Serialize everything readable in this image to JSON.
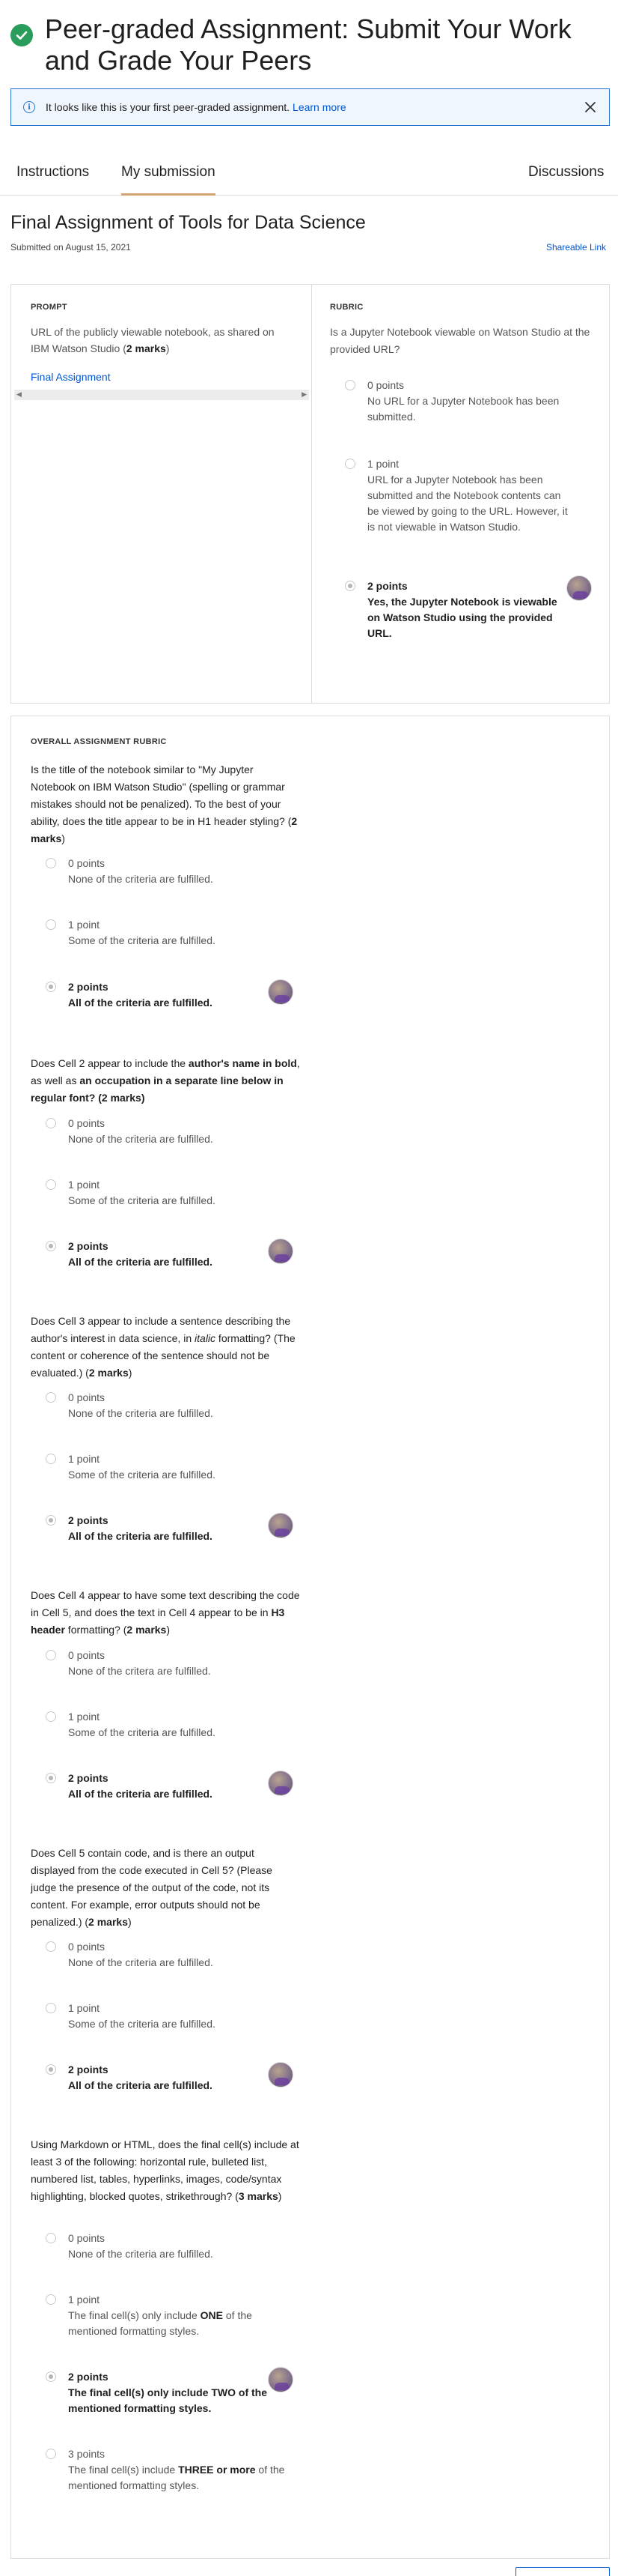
{
  "header": {
    "title": "Peer-graded Assignment: Submit Your Work and Grade Your Peers"
  },
  "banner": {
    "text": "It looks like this is your first peer-graded assignment.",
    "link": "Learn more"
  },
  "tabs": {
    "instructions": "Instructions",
    "my_submission": "My submission",
    "discussions": "Discussions"
  },
  "submission": {
    "title": "Final Assignment of Tools for Data Science",
    "submitted_on": "Submitted on August 15, 2021",
    "share_link": "Shareable Link"
  },
  "prompt": {
    "label": "PROMPT",
    "text_a": "URL of the publicly viewable notebook, as shared on IBM Watson Studio (",
    "text_b": "2 marks",
    "text_c": ")",
    "link": "Final Assignment"
  },
  "rubric": {
    "label": "RUBRIC",
    "question": "Is a Jupyter Notebook viewable on Watson Studio at the provided URL?",
    "options": [
      {
        "points": "0 points",
        "desc": "No URL for a Jupyter Notebook has been submitted."
      },
      {
        "points": "1 point",
        "desc": "URL for a Jupyter Notebook has been submitted and the Notebook contents can be viewed by going to the URL. However, it is not viewable in Watson Studio."
      },
      {
        "points": "2 points",
        "desc": "Yes, the Jupyter Notebook is viewable on Watson Studio using the provided URL."
      }
    ]
  },
  "overall": {
    "label": "OVERALL ASSIGNMENT RUBRIC",
    "q1": {
      "text": "Is the title of the notebook similar to \"My Jupyter Notebook on IBM Watson Studio\" (spelling or grammar mistakes should not be penalized). To the best of your ability, does the title appear to be in H1 header styling? (",
      "marks": "2 marks",
      "end": ")"
    },
    "q2": {
      "a": "Does Cell 2 appear to include the ",
      "b": "author's name in bold",
      "c": ", as well as ",
      "d": "an occupation in a separate line below in regular font?",
      "e": " (2 marks)"
    },
    "q3": {
      "a": "Does Cell 3 appear to include a sentence describing the author's interest in data science, in ",
      "b": "italic",
      "c": " formatting? (The content or coherence of the sentence should not be evaluated.) (",
      "d": "2 marks",
      "e": ")"
    },
    "q4": {
      "a": "Does Cell 4 appear to have some text describing the code in Cell 5, and does the text in Cell 4 appear to be in ",
      "b": "H3 header",
      "c": " formatting? (",
      "d": "2 marks",
      "e": ")"
    },
    "q5": {
      "a": "Does Cell 5 contain code, and is there an output displayed from the code executed in Cell 5? (Please judge the presence of the output of the code, not its content. For example, error outputs should not be penalized.) (",
      "b": "2 marks",
      "c": ")"
    },
    "q6": {
      "a": "Using Markdown or HTML, does the final cell(s) include at least 3 of the following: horizontal rule, bulleted list, numbered list, tables, hyperlinks, images, code/syntax highlighting, blocked quotes, strikethrough? (",
      "b": "3 marks",
      "c": ")"
    },
    "opts": {
      "p0": "0 points",
      "p1": "1 point",
      "p2": "2 points",
      "p3": "3 points",
      "none": "None of the criteria are fulfilled.",
      "some": "Some of the criteria are fulfilled.",
      "all": "All of the criteria are fulfilled.",
      "none_typo": "None of the critera are fulfilled."
    },
    "q6_opts": {
      "one_a": "The final cell(s) only include ",
      "one_b": "ONE",
      "one_c": " of the mentioned formatting styles.",
      "two": "The final cell(s) only include TWO of the mentioned formatting styles.",
      "three_a": "The final cell(s) include ",
      "three_b": "THREE or more",
      "three_c": " of the mentioned formatting styles."
    }
  }
}
